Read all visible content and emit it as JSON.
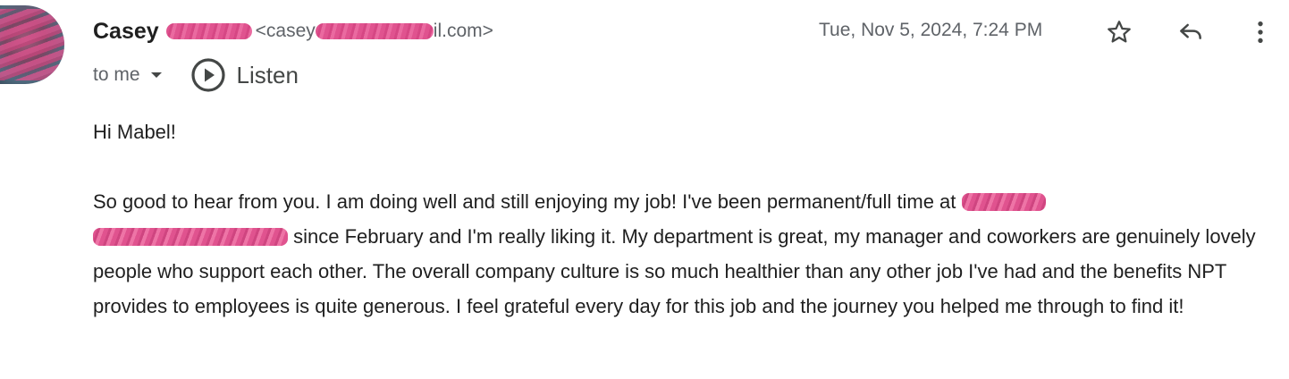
{
  "sender": {
    "name": "Casey",
    "email_prefix": "<casey",
    "email_suffix": "il.com>"
  },
  "recipient": {
    "label": "to me"
  },
  "listen": {
    "label": "Listen"
  },
  "date": "Tue, Nov 5, 2024, 7:24 PM",
  "icons": {
    "star": "star-icon",
    "reply": "reply-icon",
    "more": "more-vert-icon",
    "play": "play-circle-icon",
    "dropdown": "chevron-down-icon"
  },
  "message": {
    "greeting": "Hi Mabel!",
    "p1_before_redaction": "So good to hear from you. I am doing well and still enjoying my job! I've been permanent/full time at ",
    "p1_after_redaction": " since February and I'm really liking it. My department is great, my manager and coworkers are genuinely lovely people who support each other. The overall company culture is so much healthier than any other job I've had and the benefits NPT provides to employees is quite generous. I feel grateful every day for this job and the journey you helped me through to find it!"
  },
  "colors": {
    "redaction": "#e0538f",
    "text_primary": "#1f1f1f",
    "text_secondary": "#5f6368"
  }
}
